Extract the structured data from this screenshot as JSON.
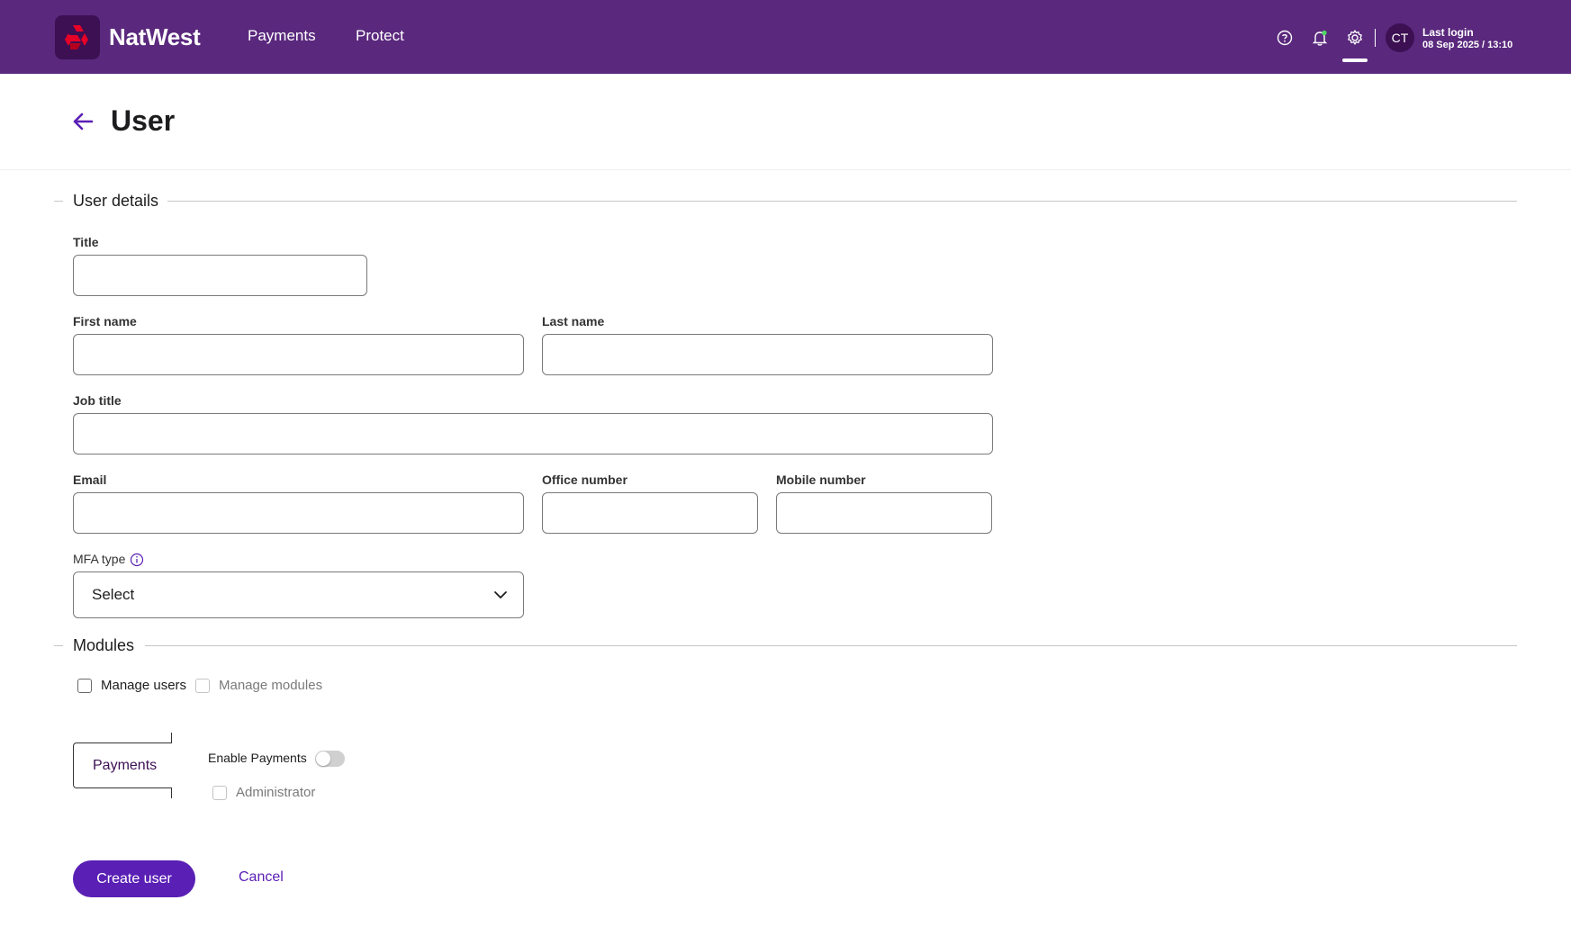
{
  "header": {
    "brand": "NatWest",
    "nav": [
      "Payments",
      "Protect"
    ],
    "avatar_initials": "CT",
    "last_login_label": "Last login",
    "last_login_time": "08 Sep 2025 / 13:10",
    "colors": {
      "bar": "#5a287d",
      "notification_dot": "#4cd964"
    }
  },
  "page": {
    "title": "User"
  },
  "user_details": {
    "section_title": "User details",
    "title_label": "Title",
    "first_name_label": "First name",
    "last_name_label": "Last name",
    "job_title_label": "Job title",
    "email_label": "Email",
    "office_number_label": "Office number",
    "mobile_number_label": "Mobile number",
    "mfa_type_label": "MFA type",
    "mfa_type_value": "Select"
  },
  "modules": {
    "section_title": "Modules",
    "manage_users_label": "Manage users",
    "manage_modules_label": "Manage modules",
    "payments_tab_label": "Payments",
    "enable_payments_label": "Enable Payments",
    "enable_payments_on": false,
    "administrator_label": "Administrator"
  },
  "actions": {
    "create_label": "Create user",
    "cancel_label": "Cancel",
    "accent": "#5a1fb5"
  }
}
